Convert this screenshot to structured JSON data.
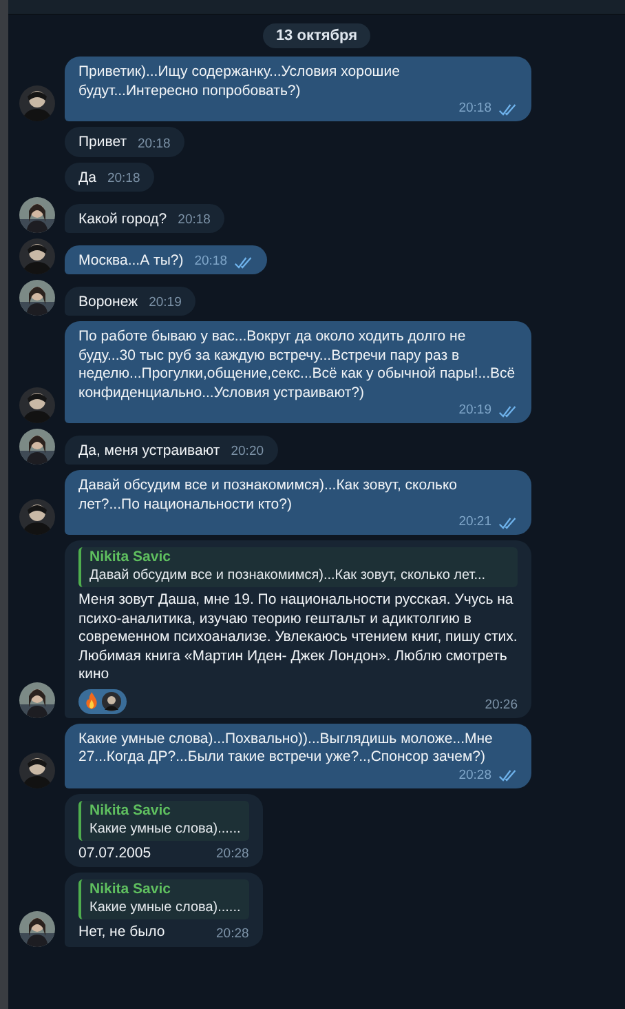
{
  "date_divider": "13 октября",
  "messages": [
    {
      "kind": "out",
      "avatar": true,
      "text": "Приветик)...Ищу содержанку...Условия хорошие будут...Интересно попробовать?)",
      "time": "20:18",
      "read": true
    },
    {
      "kind": "in",
      "avatar": false,
      "text": "Привет",
      "time": "20:18"
    },
    {
      "kind": "in",
      "avatar": false,
      "text": "Да",
      "time": "20:18"
    },
    {
      "kind": "in",
      "avatar": true,
      "text": "Какой город?",
      "time": "20:18"
    },
    {
      "kind": "out",
      "avatar": true,
      "text": "Москва...А ты?)",
      "time": "20:18",
      "read": true
    },
    {
      "kind": "in",
      "avatar": true,
      "text": "Воронеж",
      "time": "20:19"
    },
    {
      "kind": "out",
      "avatar": true,
      "text": "По работе бываю у вас...Вокруг да около ходить долго не буду...30 тыс руб за каждую встречу...Встречи пару раз в неделю...Прогулки,общение,секс...Всё как у обычной пары!...Всё конфиденциально...Условия устраивают?)",
      "time": "20:19",
      "read": true
    },
    {
      "kind": "in",
      "avatar": true,
      "text": "Да, меня устраивают",
      "time": "20:20"
    },
    {
      "kind": "out",
      "avatar": true,
      "text": "Давай обсудим все и познакомимся)...Как зовут, сколько лет?...По национальности кто?)",
      "time": "20:21",
      "read": true
    },
    {
      "kind": "in",
      "avatar": true,
      "reply": {
        "author": "Nikita Savic",
        "text": "Давай обсудим все и познакомимся)...Как зовут, сколько лет..."
      },
      "text": "Меня зовут Даша, мне 19. По национальности русская. Учусь на психо-аналитика, изучаю теорию гештальт и адиктолгию в современном психоанализе. Увлекаюсь чтением книг, пишу стих. Любимая книга «Мартин Иден- Джек Лондон». Люблю смотреть кино",
      "time": "20:26",
      "reactions": [
        {
          "kind": "fire"
        },
        {
          "kind": "avatar"
        }
      ]
    },
    {
      "kind": "out",
      "avatar": true,
      "text": "Какие умные слова)...Похвально))...Выглядишь моложе...Мне 27...Когда ДР?...Были такие встречи уже?..,Спонсор зачем?)",
      "time": "20:28",
      "read": true
    },
    {
      "kind": "in",
      "avatar": false,
      "reply": {
        "author": "Nikita Savic",
        "text": "Какие умные слова)......"
      },
      "text": "07.07.2005",
      "time": "20:28"
    },
    {
      "kind": "in",
      "avatar": true,
      "reply": {
        "author": "Nikita Savic",
        "text": "Какие умные слова)......"
      },
      "text": "Нет, не было",
      "time": "20:28"
    }
  ]
}
